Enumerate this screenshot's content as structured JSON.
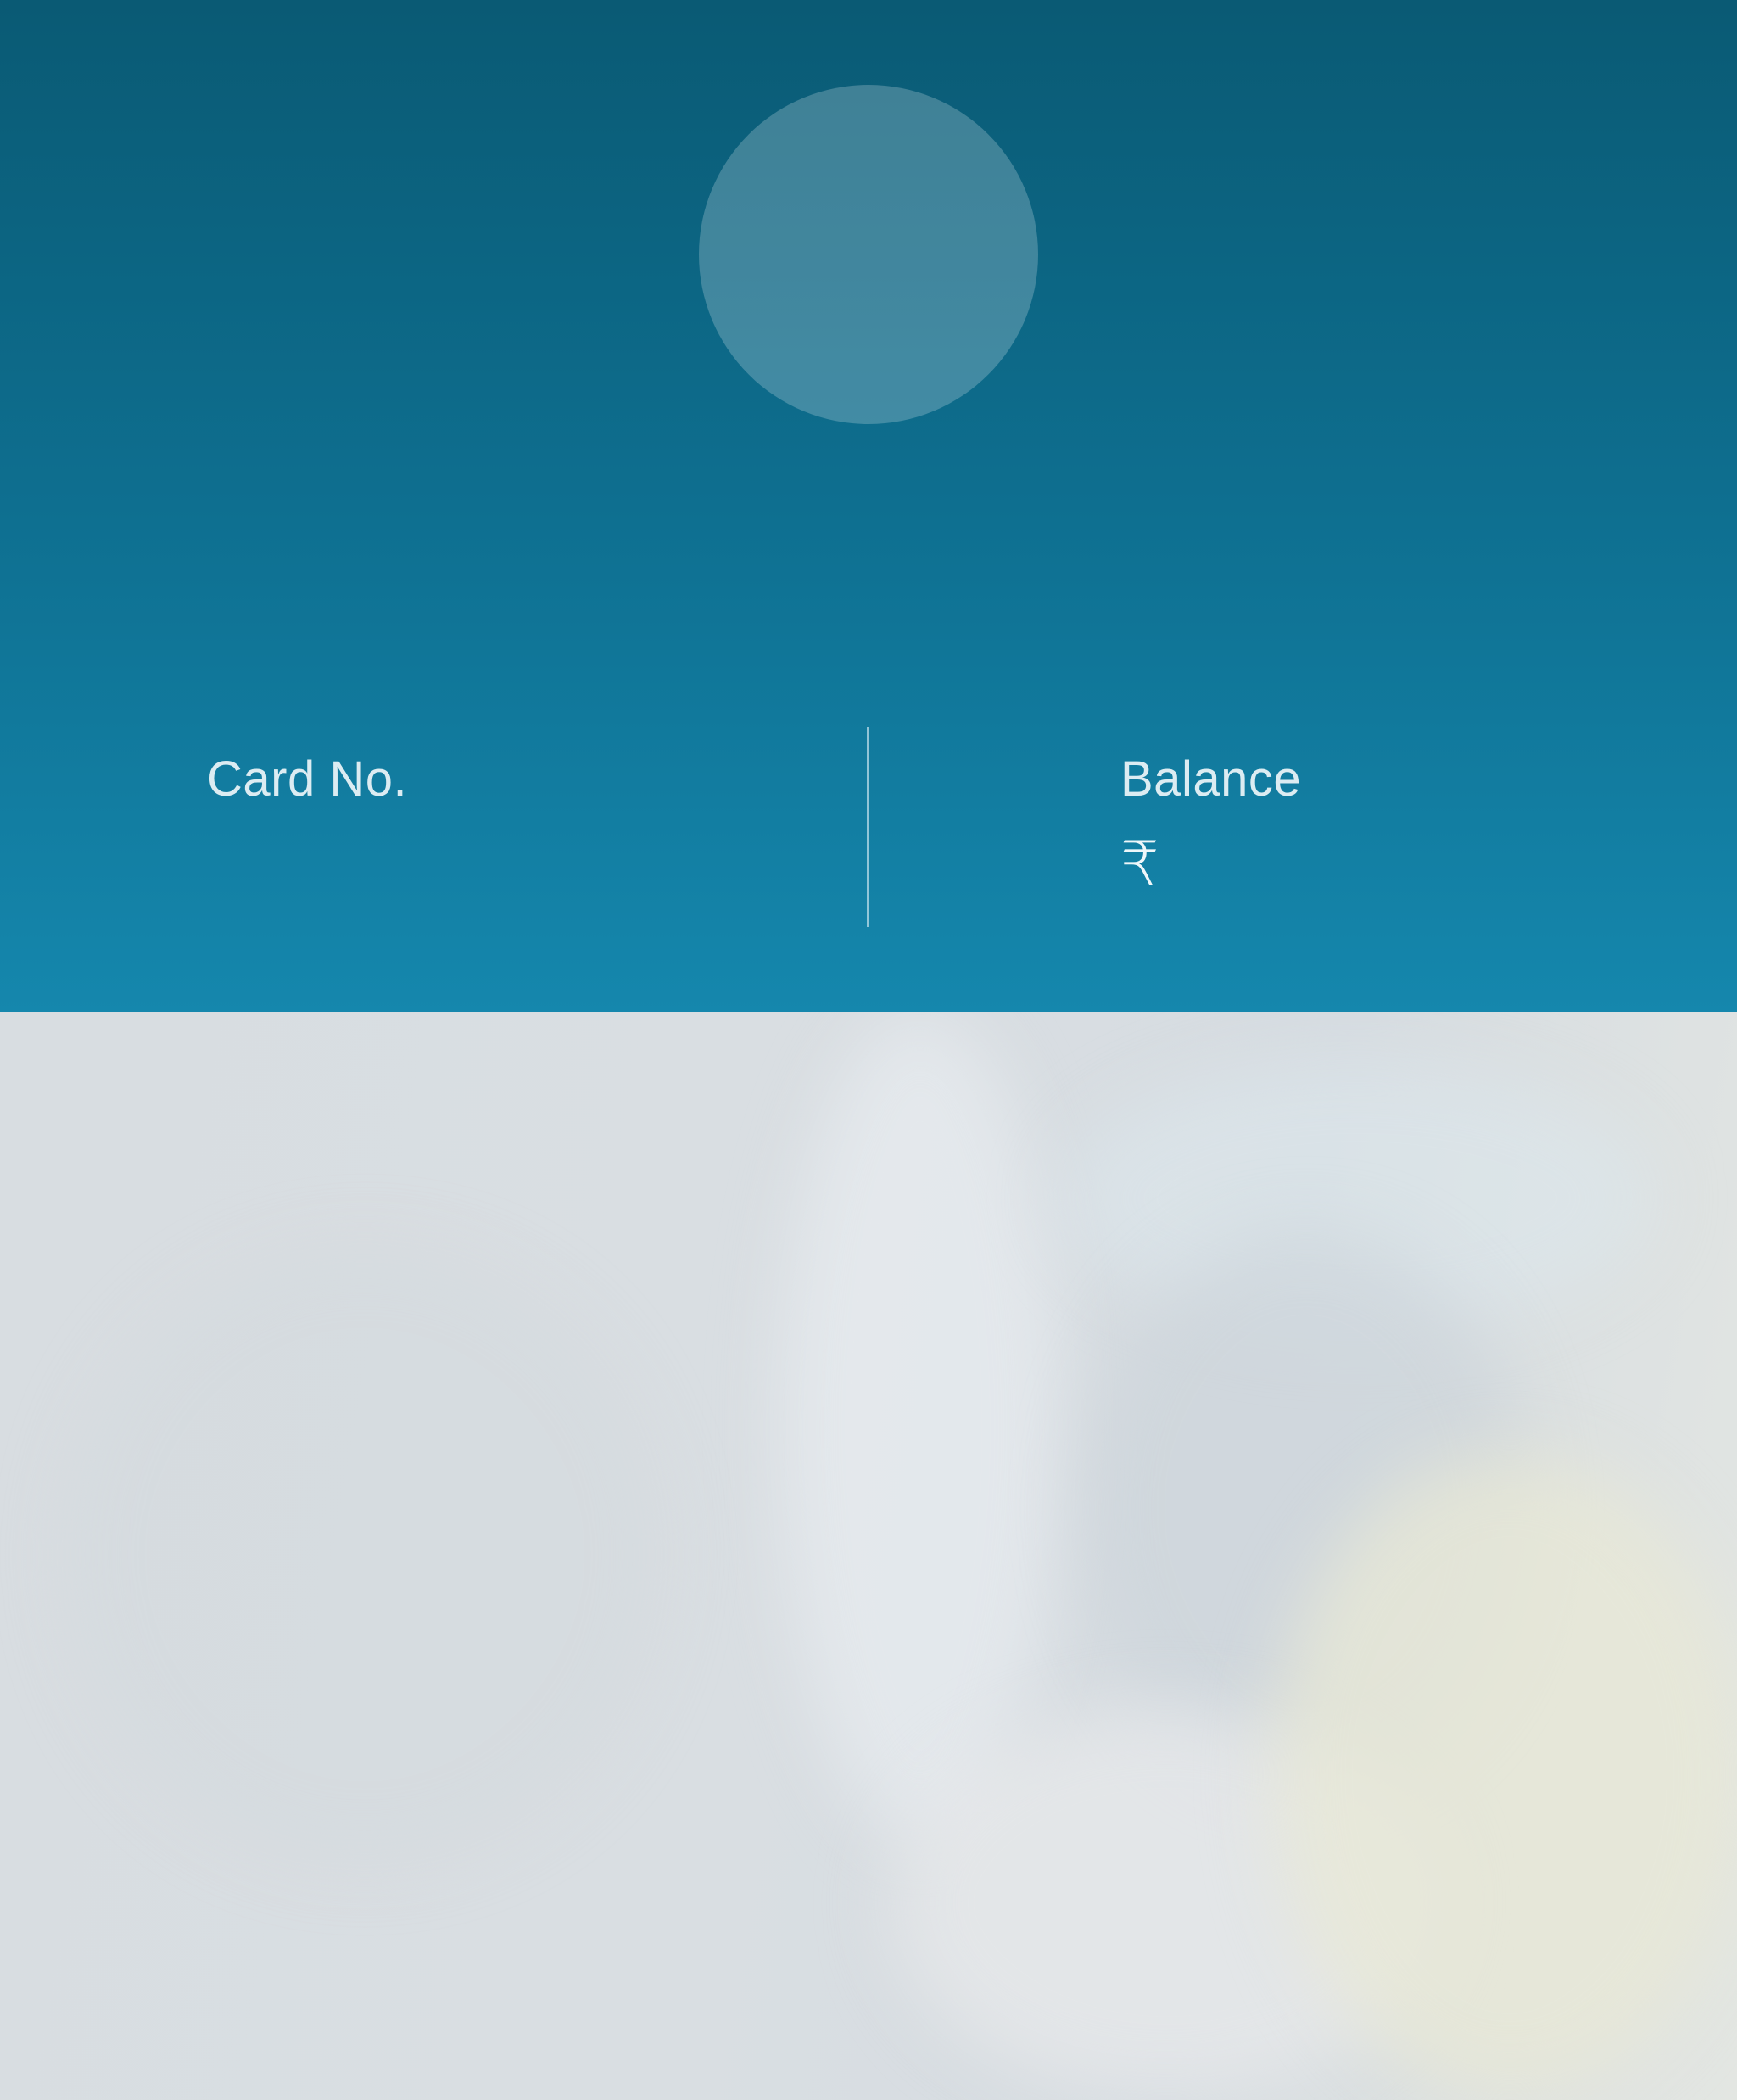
{
  "profile": {
    "avatar_icon": "user-avatar-placeholder"
  },
  "card": {
    "label": "Card No.",
    "value": ""
  },
  "balance": {
    "label": "Balance",
    "currency_symbol": "₹",
    "amount": ""
  },
  "colors": {
    "header_top": "#0a5a74",
    "header_bottom": "#1587ad",
    "label_text": "#dcecf2",
    "photo_overlay": "#dadee1"
  }
}
